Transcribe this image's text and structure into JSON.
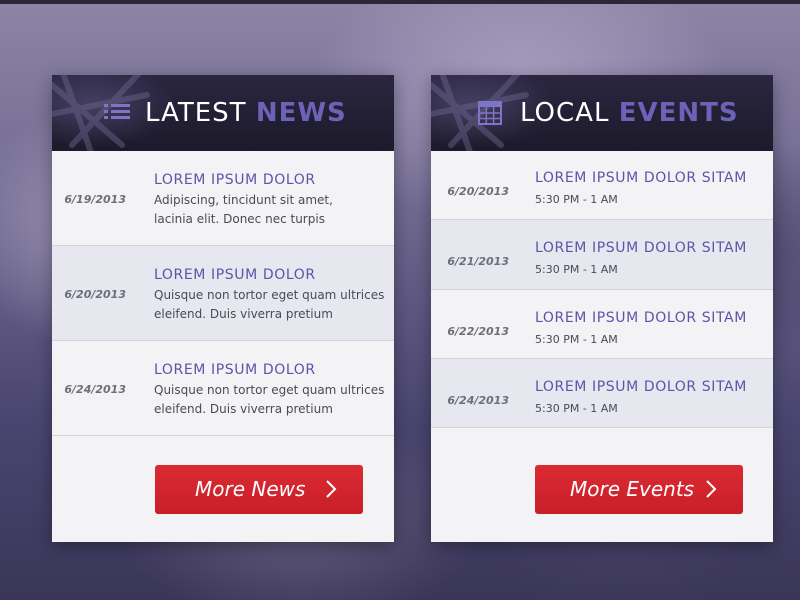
{
  "news": {
    "title_light": "LATEST",
    "title_bold": "NEWS",
    "icon": "list-icon",
    "items": [
      {
        "date": "6/19/2013",
        "title": "LOREM IPSUM DOLOR",
        "line1": "Adipiscing, tincidunt sit amet,",
        "line2": "lacinia elit. Donec nec turpis"
      },
      {
        "date": "6/20/2013",
        "title": "LOREM IPSUM DOLOR",
        "line1": "Quisque non tortor eget quam ultrices",
        "line2": "eleifend. Duis viverra pretium"
      },
      {
        "date": "6/24/2013",
        "title": "LOREM IPSUM DOLOR",
        "line1": "Quisque non tortor eget quam ultrices",
        "line2": "eleifend. Duis viverra pretium"
      }
    ],
    "button_label": "More News"
  },
  "events": {
    "title_light": "LOCAL",
    "title_bold": "EVENTS",
    "icon": "calendar-icon",
    "items": [
      {
        "date": "6/20/2013",
        "title": "LOREM IPSUM DOLOR SITAM",
        "time": "5:30 PM - 1 AM"
      },
      {
        "date": "6/21/2013",
        "title": "LOREM IPSUM DOLOR SITAM",
        "time": "5:30 PM - 1 AM"
      },
      {
        "date": "6/22/2013",
        "title": "LOREM IPSUM DOLOR SITAM",
        "time": "5:30 PM - 1 AM"
      },
      {
        "date": "6/24/2013",
        "title": "LOREM IPSUM DOLOR SITAM",
        "time": "5:30 PM - 1 AM"
      }
    ],
    "button_label": "More Events"
  },
  "colors": {
    "accent_purple": "#6c62b8",
    "title_purple": "#5c54a8",
    "button_red": "#d4252d",
    "header_dark": "#1f1c2e"
  }
}
